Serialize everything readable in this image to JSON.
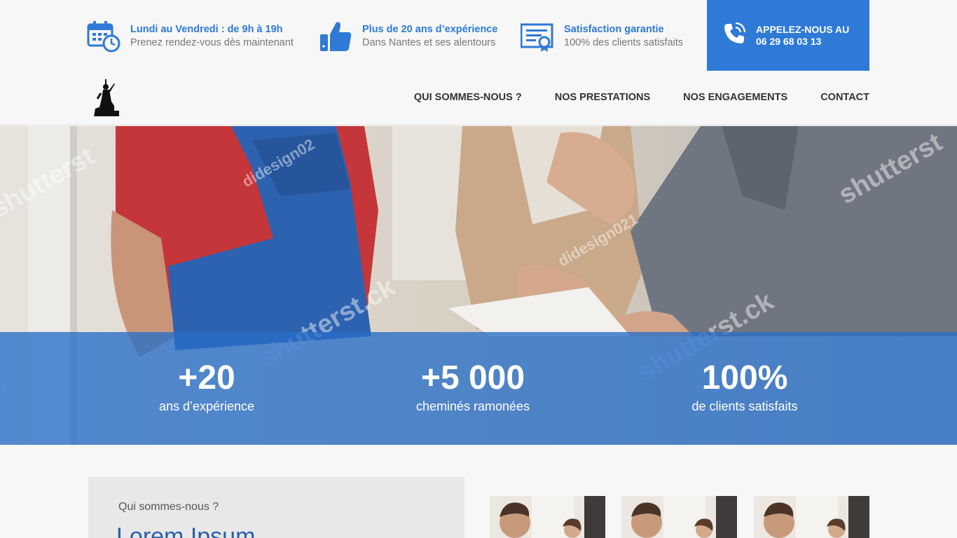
{
  "topbar": {
    "hours": {
      "title": "Lundi au Vendredi : de 9h à 19h",
      "subtitle": "Prenez rendez-vous dès maintenant",
      "icon": "calendar-clock-icon"
    },
    "experience": {
      "title": "Plus de 20 ans d’expérience",
      "subtitle": "Dans Nantes et ses alentours",
      "icon": "thumbs-up-icon"
    },
    "satisfaction": {
      "title": "Satisfaction garantie",
      "subtitle": "100% des clients satisfaits",
      "icon": "certificate-icon"
    },
    "call": {
      "line1": "APPELEZ-NOUS AU",
      "line2": "06 29 68 03 13",
      "icon": "phone-icon"
    }
  },
  "nav": {
    "items": [
      "QUI SOMMES-NOUS ?",
      "NOS PRESTATIONS",
      "NOS ENGAGEMENTS",
      "CONTACT"
    ]
  },
  "hero": {
    "watermarks": [
      "shutterst",
      "didesign02",
      "didesign021",
      "shutterst.ck",
      "shutterst.ck",
      "shutterst",
      "ck"
    ]
  },
  "stats": [
    {
      "value": "+20",
      "label": "ans d’expérience"
    },
    {
      "value": "+5 000",
      "label": "cheminés ramonées"
    },
    {
      "value": "100%",
      "label": "de clients satisfaits"
    }
  ],
  "about": {
    "subtitle": "Qui sommes-nous ?",
    "heading": "Lorem Ipsum"
  },
  "colors": {
    "accent": "#2f7ad6",
    "stats_band": "#286ec8",
    "heading": "#2a5fa8"
  }
}
